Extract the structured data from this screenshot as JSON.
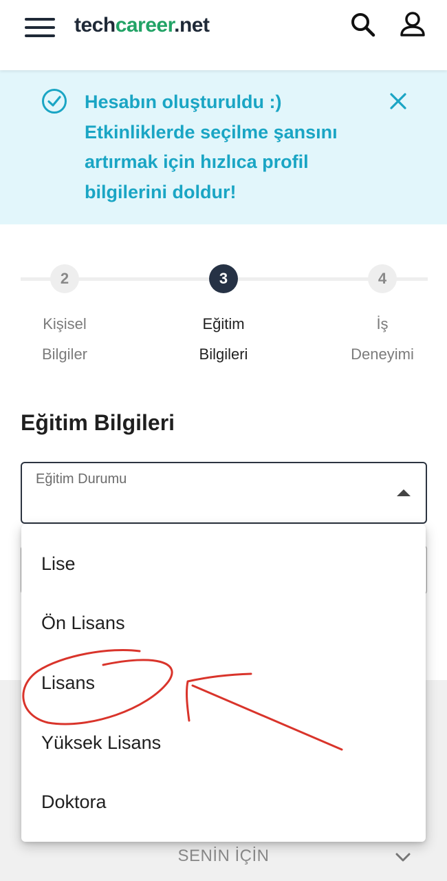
{
  "header": {
    "logo_part1": "tech",
    "logo_part2": "career",
    "logo_part3": ".net",
    "icons": [
      "menu-icon",
      "search-icon",
      "user-icon"
    ]
  },
  "alert": {
    "line1": "Hesabın oluşturuldu :)",
    "line2": "Etkinliklerde seçilme şansını",
    "line3": "artırmak için hızlıca profil",
    "line4": "bilgilerini doldur!",
    "icons": [
      "check-circle-icon",
      "close-icon"
    ]
  },
  "stepper": {
    "steps": [
      {
        "number": "2",
        "label_line1": "Kişisel",
        "label_line2": "Bilgiler",
        "active": false
      },
      {
        "number": "3",
        "label_line1": "Eğitim",
        "label_line2": "Bilgileri",
        "active": true
      },
      {
        "number": "4",
        "label_line1": "İş",
        "label_line2": "Deneyimi",
        "active": false
      }
    ]
  },
  "section": {
    "title": "Eğitim Bilgileri",
    "select_label": "Eğitim Durumu"
  },
  "dropdown": {
    "options": [
      "Lise",
      "Ön Lisans",
      "Lisans",
      "Yüksek Lisans",
      "Doktora"
    ]
  },
  "footer": {
    "label": "SENİN İÇİN"
  },
  "colors": {
    "brand_dark": "#1f2937",
    "brand_green": "#22a366",
    "alert_bg": "#e2f6fb",
    "alert_text": "#1aa5c4",
    "step_active": "#263245",
    "annotation_red": "#d9342b"
  }
}
